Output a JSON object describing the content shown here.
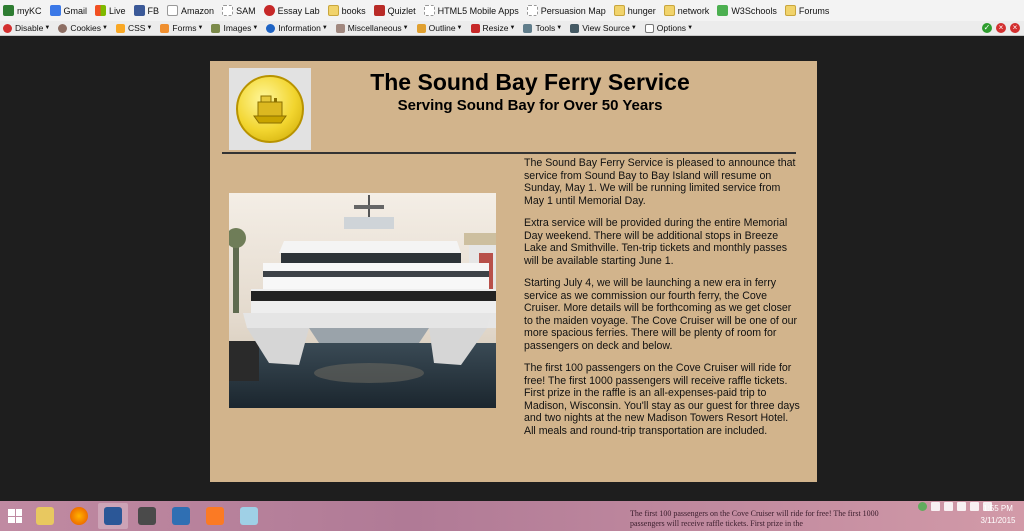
{
  "bookmarks": [
    {
      "label": "myKC",
      "icon": "kc-icon"
    },
    {
      "label": "Gmail",
      "icon": "google-icon"
    },
    {
      "label": "Live",
      "icon": "windows-icon"
    },
    {
      "label": "FB",
      "icon": "facebook-icon"
    },
    {
      "label": "Amazon",
      "icon": "amazon-icon"
    },
    {
      "label": "SAM",
      "icon": "page-icon"
    },
    {
      "label": "Essay Lab",
      "icon": "essay-lab-icon"
    },
    {
      "label": "books",
      "icon": "folder-icon"
    },
    {
      "label": "Quizlet",
      "icon": "quizlet-icon"
    },
    {
      "label": "HTML5 Mobile Apps",
      "icon": "page-icon"
    },
    {
      "label": "Persuasion Map",
      "icon": "page-icon"
    },
    {
      "label": "hunger",
      "icon": "folder-icon"
    },
    {
      "label": "network",
      "icon": "folder-icon"
    },
    {
      "label": "W3Schools",
      "icon": "w3schools-icon"
    },
    {
      "label": "Forums",
      "icon": "folder-icon"
    }
  ],
  "devbar": [
    {
      "label": "Disable",
      "icon": "disable-icon"
    },
    {
      "label": "Cookies",
      "icon": "cookies-icon"
    },
    {
      "label": "CSS",
      "icon": "css-icon"
    },
    {
      "label": "Forms",
      "icon": "forms-icon"
    },
    {
      "label": "Images",
      "icon": "images-icon"
    },
    {
      "label": "Information",
      "icon": "info-icon"
    },
    {
      "label": "Miscellaneous",
      "icon": "misc-icon"
    },
    {
      "label": "Outline",
      "icon": "outline-icon"
    },
    {
      "label": "Resize",
      "icon": "resize-icon"
    },
    {
      "label": "Tools",
      "icon": "tools-icon"
    },
    {
      "label": "View Source",
      "icon": "view-source-icon"
    },
    {
      "label": "Options",
      "icon": "options-icon"
    }
  ],
  "page": {
    "title": "The Sound Bay Ferry Service",
    "subtitle": "Serving Sound Bay for Over 50 Years",
    "paragraphs": [
      "The Sound Bay Ferry Service is pleased to announce that service from Sound Bay to Bay Island will resume on Sunday, May 1. We will be running limited service from May 1 until Memorial Day.",
      "Extra service will be provided during the entire Memorial Day weekend. There will be additional stops in Breeze Lake and Smithville. Ten-trip tickets and monthly passes will be available starting June 1.",
      "Starting July 4, we will be launching a new era in ferry service as we commission our fourth ferry, the Cove Cruiser. More details will be forthcoming as we get closer to the maiden voyage. The Cove Cruiser will be one of our more spacious ferries. There will be plenty of room for passengers on deck and below.",
      "The first 100 passengers on the Cove Cruiser will ride for free! The first 1000 passengers will receive raffle tickets. First prize in the raffle is an all-expenses-paid trip to Madison, Wisconsin. You'll stay as our guest for three days and two nights at the new Madison Towers Resort Hotel. All meals and round-trip transportation are included."
    ]
  },
  "taskbar": {
    "preview_text": "The first 100 passengers on the Cove Cruiser will ride for free! The first 1000 passengers will receive raffle tickets. First prize in the",
    "time": "1:55 PM",
    "date": "3/11/2015"
  },
  "colors": {
    "page_background": "#d2b48c",
    "window_background": "#1e1e1e"
  }
}
